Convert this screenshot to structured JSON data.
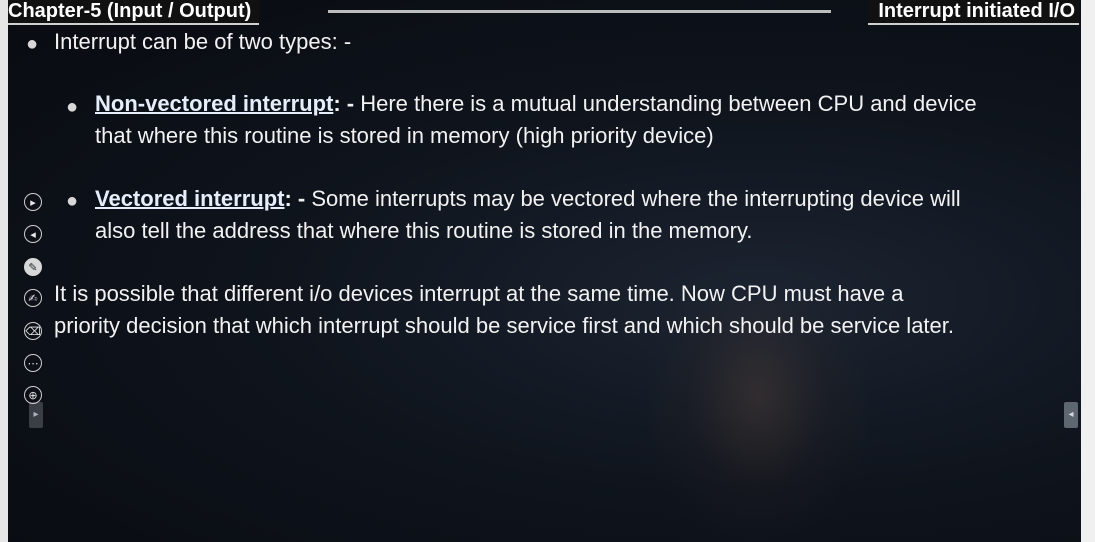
{
  "header": {
    "left_title": "Chapter-5 (Input / Output)",
    "right_title": "Interrupt initiated I/O"
  },
  "content": {
    "intro": "Interrupt can be of two types: -",
    "items": [
      {
        "term": "Non-vectored interrupt",
        "separator": ": -",
        "line1": " Here there is a mutual understanding between CPU and device",
        "line2": "that where this routine is stored in memory (high priority device)"
      },
      {
        "term": "Vectored interrupt",
        "separator": ": -",
        "line1": " Some interrupts may be vectored where the interrupting device will",
        "line2": "also tell the address that where this routine is stored in the memory."
      }
    ],
    "paragraph_line1": "It is possible that different i/o devices interrupt at the same time. Now CPU must have a",
    "paragraph_line2": "priority decision that which interrupt should be service first and which should be service later."
  },
  "toolbar": {
    "icons": [
      "play-icon",
      "back-icon",
      "pen-icon",
      "highlighter-icon",
      "eraser-icon",
      "more-icon",
      "zoom-icon"
    ]
  }
}
